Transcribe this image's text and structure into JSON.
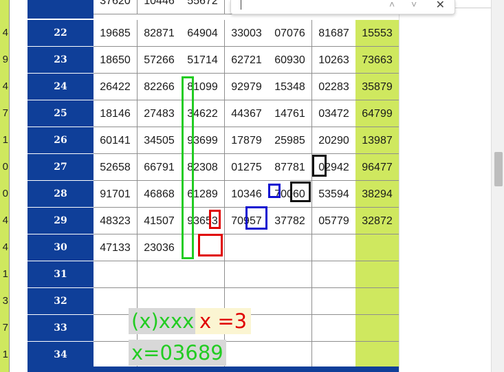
{
  "left_column_digits": [
    "4",
    "9",
    "4",
    "7",
    "1",
    "0",
    "0",
    "4",
    "4",
    "1",
    "3",
    "7",
    "1"
  ],
  "partial_top_row": [
    "37620",
    "10446",
    "55672"
  ],
  "rows": [
    {
      "label": "22",
      "cells": [
        "19685",
        "82871",
        "64904",
        "33003",
        "07076",
        "81687",
        "15553"
      ]
    },
    {
      "label": "23",
      "cells": [
        "18650",
        "57266",
        "51714",
        "62721",
        "60930",
        "10263",
        "73663"
      ]
    },
    {
      "label": "24",
      "cells": [
        "26422",
        "82266",
        "81099",
        "92979",
        "15348",
        "02283",
        "35879"
      ]
    },
    {
      "label": "25",
      "cells": [
        "18146",
        "27483",
        "34622",
        "44367",
        "14761",
        "03472",
        "64799"
      ]
    },
    {
      "label": "26",
      "cells": [
        "60141",
        "34505",
        "93699",
        "17879",
        "25985",
        "20290",
        "13987"
      ]
    },
    {
      "label": "27",
      "cells": [
        "52658",
        "66791",
        "82308",
        "01275",
        "87781",
        "02942",
        "96477"
      ]
    },
    {
      "label": "28",
      "cells": [
        "91701",
        "46868",
        "61289",
        "10346",
        "70060",
        "53594",
        "38294"
      ]
    },
    {
      "label": "29",
      "cells": [
        "48323",
        "41507",
        "93653",
        "70957",
        "37782",
        "05779",
        "32872"
      ]
    },
    {
      "label": "30",
      "cells": [
        "47133",
        "23036",
        "",
        "",
        "",
        "",
        ""
      ]
    },
    {
      "label": "31",
      "cells": [
        "",
        "",
        "",
        "",
        "",
        "",
        ""
      ]
    },
    {
      "label": "32",
      "cells": [
        "",
        "",
        "",
        "",
        "",
        "",
        ""
      ]
    },
    {
      "label": "33",
      "cells": [
        "",
        "",
        "",
        "",
        "",
        "",
        ""
      ]
    },
    {
      "label": "34",
      "cells": [
        "",
        "",
        "",
        "",
        "",
        "",
        ""
      ]
    }
  ],
  "annotations": {
    "formula_green": "(x)xxx",
    "formula_red": "x =3",
    "result": "x=03689"
  },
  "colors": {
    "row_header": "#0f3f99",
    "highlight_column": "#cfe85f",
    "green_mark": "#22cc22",
    "red_mark": "#e00000",
    "blue_mark": "#1010d0",
    "black_mark": "#111111"
  },
  "find_bar": {
    "prev_icon": "chevron-up-icon",
    "next_icon": "chevron-down-icon",
    "close_icon": "close-icon"
  }
}
